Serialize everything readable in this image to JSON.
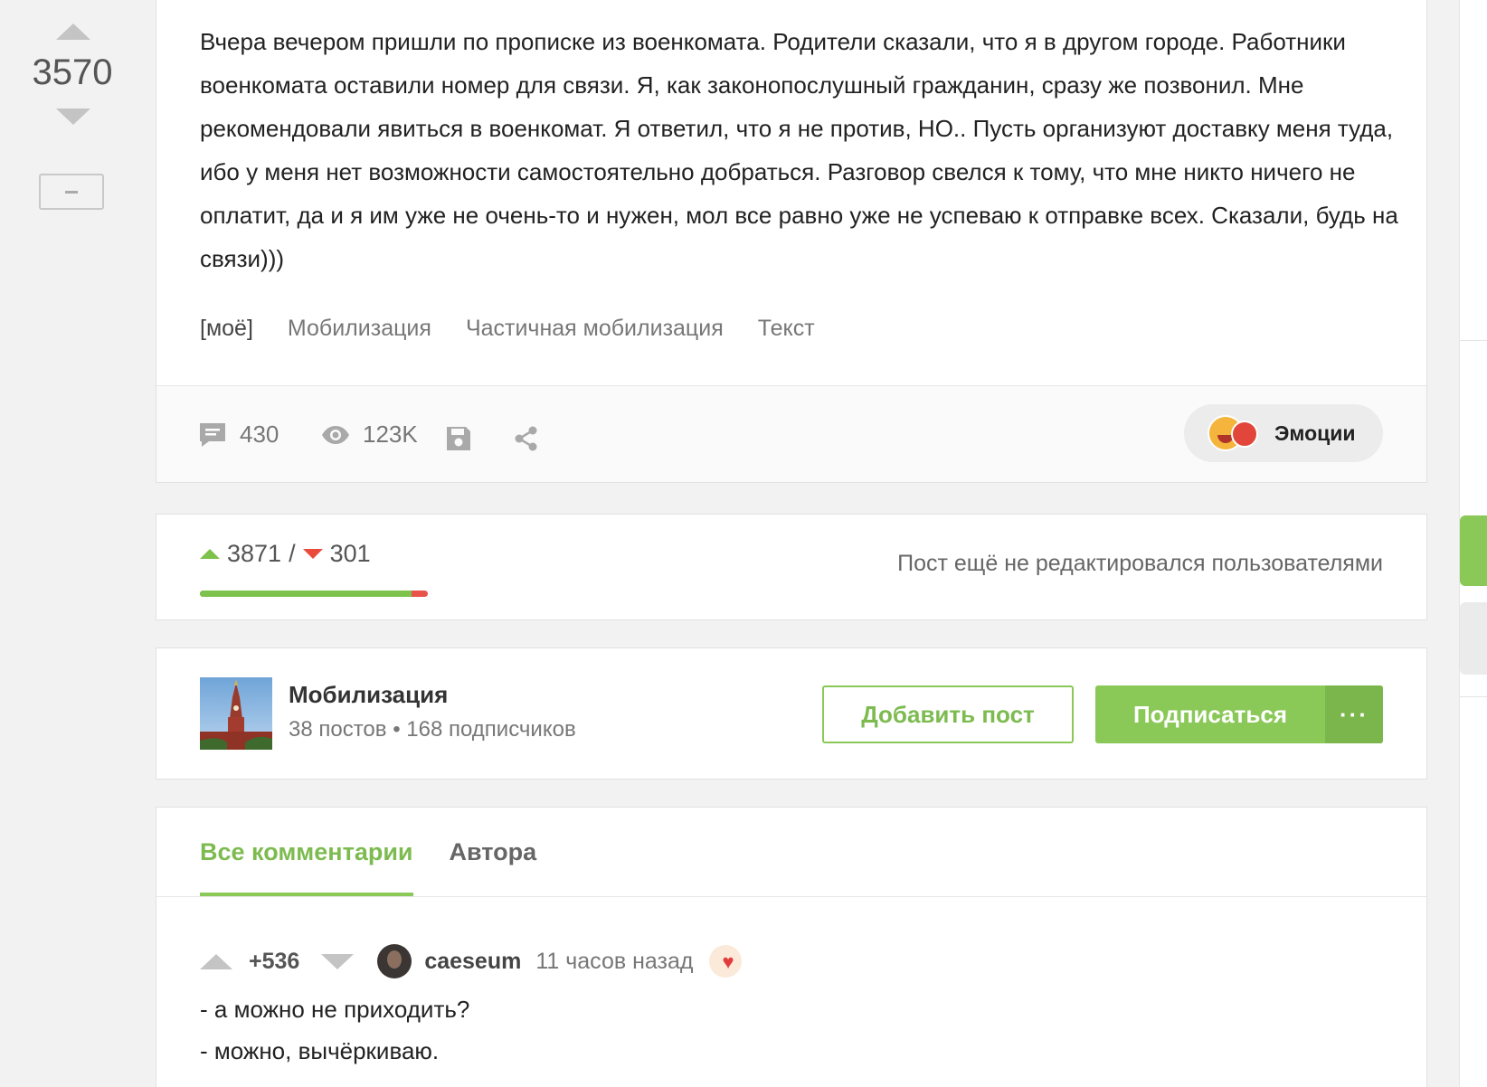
{
  "post": {
    "score": "3570",
    "paragraph": "Вчера вечером пришли по прописке из военкомата. Родители сказали, что я в другом городе. Работники военкомата оставили номер для связи. Я, как законопослушный гражданин, сразу же позвонил. Мне рекомендовали явиться в военкомат. Я ответил, что я не против, НО.. Пусть организуют доставку меня туда, ибо у меня нет возможности самостоятельно добраться. Разговор свелся к тому, что мне никто ничего не оплатит, да и я им уже не очень-то и нужен, мол все равно уже не успеваю к отправке всех. Сказали, будь на связи)))",
    "tags": [
      "[моё]",
      "Мобилизация",
      "Частичная мобилизация",
      "Текст"
    ],
    "comments_count": "430",
    "views": "123K",
    "emotions_label": "Эмоции"
  },
  "rating": {
    "pluses": "3871",
    "separator": "/",
    "minuses": "301",
    "positive_fraction": 0.928,
    "edit_note": "Пост ещё не редактировался пользователями"
  },
  "community": {
    "name": "Мобилизация",
    "meta": "38 постов • 168 подписчиков",
    "add_post_label": "Добавить пост",
    "subscribe_label": "Подписаться",
    "more_label": "···"
  },
  "comments": {
    "tabs": [
      "Все комментарии",
      "Автора"
    ],
    "first": {
      "score": "+536",
      "author": "caeseum",
      "time": "11 часов назад",
      "lines": [
        "- а можно не приходить?",
        "- можно, вычёркиваю."
      ]
    }
  },
  "colors": {
    "accent": "#8ac858",
    "minus": "#e8534a"
  }
}
